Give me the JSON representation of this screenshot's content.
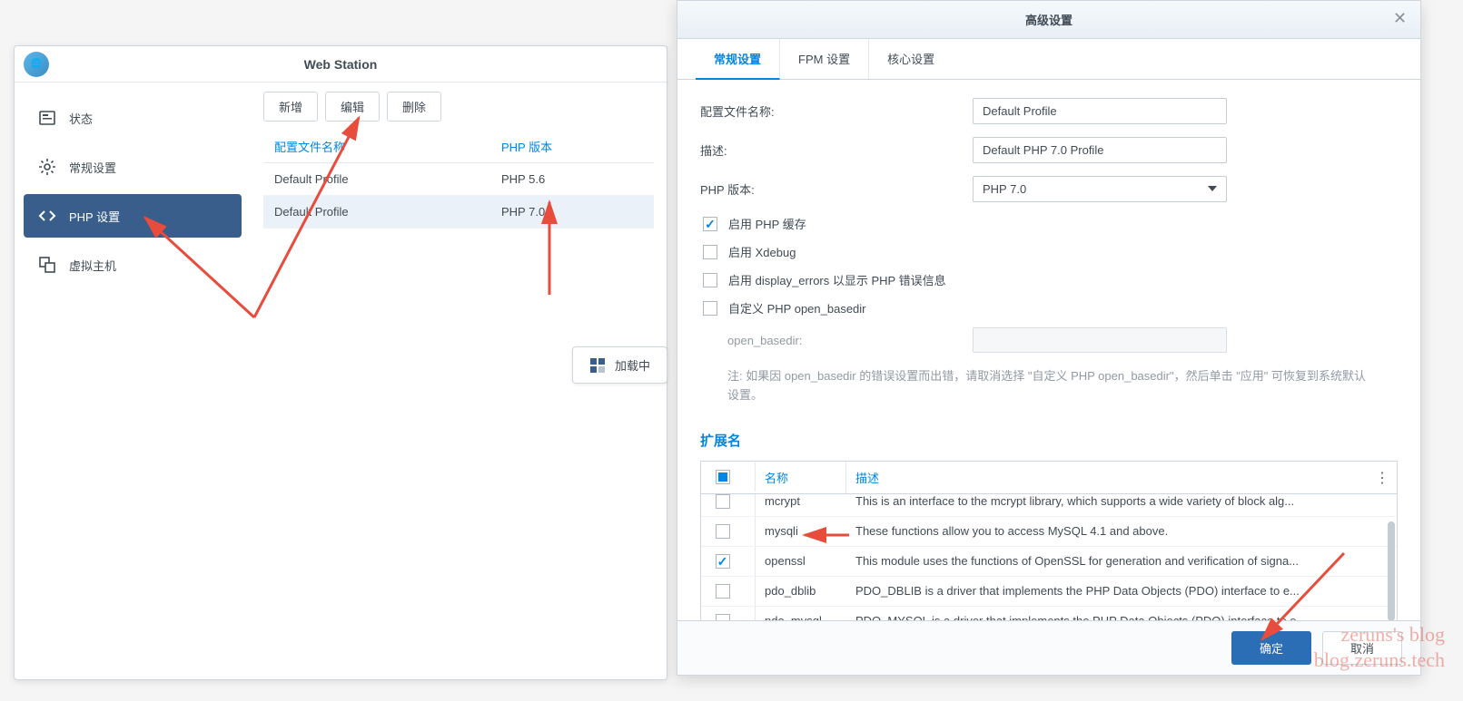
{
  "mainWindow": {
    "title": "Web Station",
    "sidebar": {
      "items": [
        {
          "label": "状态"
        },
        {
          "label": "常规设置"
        },
        {
          "label": "PHP 设置"
        },
        {
          "label": "虚拟主机"
        }
      ]
    },
    "toolbar": {
      "add": "新增",
      "edit": "编辑",
      "delete": "删除"
    },
    "table": {
      "header": {
        "col1": "配置文件名称",
        "col2": "PHP 版本"
      },
      "rows": [
        {
          "name": "Default Profile",
          "version": "PHP 5.6"
        },
        {
          "name": "Default Profile",
          "version": "PHP 7.0"
        }
      ]
    },
    "loading": "加载中"
  },
  "modal": {
    "title": "高级设置",
    "tabs": [
      "常规设置",
      "FPM 设置",
      "核心设置"
    ],
    "form": {
      "profileNameLabel": "配置文件名称:",
      "profileNameValue": "Default Profile",
      "descLabel": "描述:",
      "descValue": "Default PHP 7.0 Profile",
      "phpVersionLabel": "PHP 版本:",
      "phpVersionValue": "PHP 7.0",
      "enableCache": "启用 PHP 缓存",
      "enableXdebug": "启用 Xdebug",
      "enableDisplayErrors": "启用 display_errors 以显示 PHP 错误信息",
      "customOpenBasedir": "自定义 PHP open_basedir",
      "openBasedirLabel": "open_basedir:",
      "note": "注: 如果因 open_basedir 的错误设置而出错，请取消选择 \"自定义 PHP open_basedir\"，然后单击 \"应用\" 可恢复到系统默认设置。"
    },
    "extensions": {
      "title": "扩展名",
      "header": {
        "name": "名称",
        "desc": "描述"
      },
      "rows": [
        {
          "checked": false,
          "name": "mcrypt",
          "desc": "This is an interface to the mcrypt library, which supports a wide variety of block alg..."
        },
        {
          "checked": false,
          "name": "mysqli",
          "desc": "These functions allow you to access MySQL 4.1 and above."
        },
        {
          "checked": true,
          "name": "openssl",
          "desc": "This module uses the functions of OpenSSL for generation and verification of signa..."
        },
        {
          "checked": false,
          "name": "pdo_dblib",
          "desc": "PDO_DBLIB is a driver that implements the PHP Data Objects (PDO) interface to e..."
        },
        {
          "checked": false,
          "name": "pdo_mysql",
          "desc": "PDO_MYSQL is a driver that implements the PHP Data Objects (PDO) interface to e..."
        }
      ]
    },
    "footer": {
      "ok": "确定",
      "cancel": "取消"
    }
  },
  "watermark": {
    "line1": "zeruns's blog",
    "line2": "blog.zeruns.tech"
  }
}
